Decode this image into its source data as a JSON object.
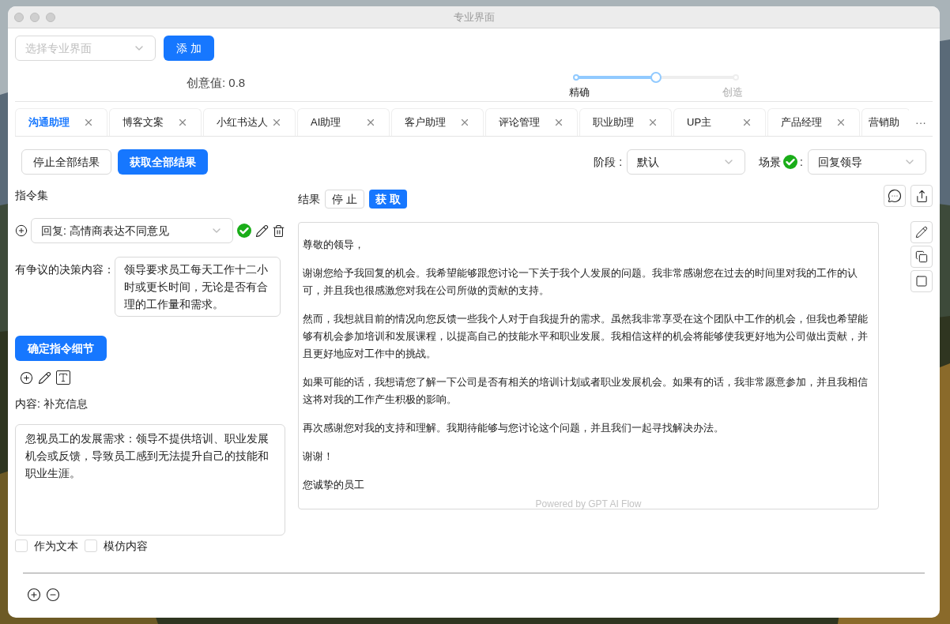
{
  "window": {
    "title": "专业界面"
  },
  "toolbar": {
    "interface_select": {
      "placeholder": "选择专业界面"
    },
    "add_button": "添 加"
  },
  "creativity": {
    "label": "创意值: 0.8",
    "level": 0.5,
    "min_label": "精确",
    "max_label": "创造"
  },
  "tabs": [
    {
      "label": "沟通助理",
      "selected": true,
      "closable": true
    },
    {
      "label": "博客文案",
      "selected": false,
      "closable": true
    },
    {
      "label": "小红书达人",
      "selected": false,
      "closable": true
    },
    {
      "label": "AI助理",
      "selected": false,
      "closable": true
    },
    {
      "label": "客户助理",
      "selected": false,
      "closable": true
    },
    {
      "label": "评论管理",
      "selected": false,
      "closable": true
    },
    {
      "label": "职业助理",
      "selected": false,
      "closable": true
    },
    {
      "label": "UP主",
      "selected": false,
      "closable": true
    },
    {
      "label": "产品经理",
      "selected": false,
      "closable": true
    },
    {
      "label": "营销助",
      "selected": false,
      "closable": false
    }
  ],
  "tabs_more": "···",
  "actions": {
    "stop_all": "停止全部结果",
    "get_all": "获取全部结果"
  },
  "stage": {
    "label": "阶段 :",
    "value": "默认"
  },
  "scene": {
    "label": "场景",
    "colon": ":",
    "value": "回复领导",
    "verified": true
  },
  "instructions": {
    "title": "指令集",
    "selected": "回复: 高情商表达不同意见",
    "verified": true,
    "fields": [
      {
        "label": "有争议的决策内容：",
        "value": "领导要求员工每天工作十二小时或更长时间，无论是否有合理的工作量和需求。"
      }
    ],
    "confirm_button": "确定指令细节",
    "content_label": "内容: 补充信息",
    "content_value": "忽视员工的发展需求：领导不提供培训、职业发展机会或反馈，导致员工感到无法提升自己的技能和职业生涯。",
    "options": [
      {
        "label": "作为文本",
        "checked": false
      },
      {
        "label": "模仿内容",
        "checked": false
      }
    ]
  },
  "result": {
    "label": "结果",
    "stop_button": "停 止",
    "get_button": "获 取",
    "paragraphs": [
      "尊敬的领导，",
      "谢谢您给予我回复的机会。我希望能够跟您讨论一下关于我个人发展的问题。我非常感谢您在过去的时间里对我的工作的认可，并且我也很感激您对我在公司所做的贡献的支持。",
      "然而，我想就目前的情况向您反馈一些我个人对于自我提升的需求。虽然我非常享受在这个团队中工作的机会，但我也希望能够有机会参加培训和发展课程，以提高自己的技能水平和职业发展。我相信这样的机会将能够使我更好地为公司做出贡献，并且更好地应对工作中的挑战。",
      "如果可能的话，我想请您了解一下公司是否有相关的培训计划或者职业发展机会。如果有的话，我非常愿意参加，并且我相信这将对我的工作产生积极的影响。",
      "再次感谢您对我的支持和理解。我期待能够与您讨论这个问题，并且我们一起寻找解决办法。",
      "谢谢！",
      "您诚挚的员工"
    ],
    "footer": "Powered by GPT AI Flow"
  }
}
